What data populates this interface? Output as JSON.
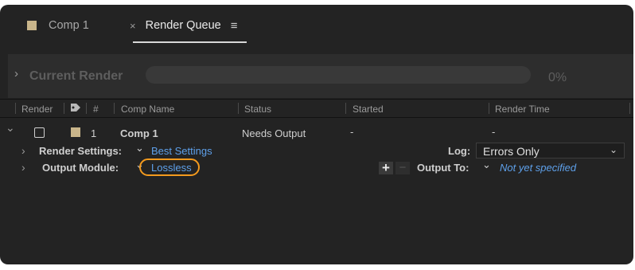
{
  "tabs": {
    "comp": {
      "label": "Comp 1",
      "swatch_color": "#c9b58a"
    },
    "render_queue": {
      "close": "×",
      "label": "Render Queue",
      "menu": "≡"
    }
  },
  "current_render": {
    "chevron": "›",
    "title": "Current Render",
    "progress_percent": 0,
    "percent_label": "0%"
  },
  "columns": {
    "render": "Render",
    "number": "#",
    "comp_name": "Comp Name",
    "status": "Status",
    "started": "Started",
    "render_time": "Render Time",
    "tag_icon": "tag-icon"
  },
  "queue_item": {
    "expand": "⌄",
    "number": "1",
    "comp_name": "Comp 1",
    "status": "Needs Output",
    "started": "-",
    "render_time": "-",
    "swatch_color": "#c9b58a"
  },
  "render_settings": {
    "chevron": "›",
    "label": "Render Settings:",
    "dropdown": "⌄",
    "value": "Best Settings",
    "log_label": "Log:",
    "log_value": "Errors Only",
    "log_arrow": "⌄"
  },
  "output_module": {
    "chevron": "›",
    "label": "Output Module:",
    "dropdown": "⌄",
    "value": "Lossless",
    "plus": "+",
    "minus": "−",
    "output_to_label": "Output To:",
    "output_to_dropdown": "⌄",
    "output_to_value": "Not yet specified"
  },
  "colors": {
    "panel": "#232323",
    "link": "#5ea0ea",
    "highlight": "#f39a1e"
  }
}
